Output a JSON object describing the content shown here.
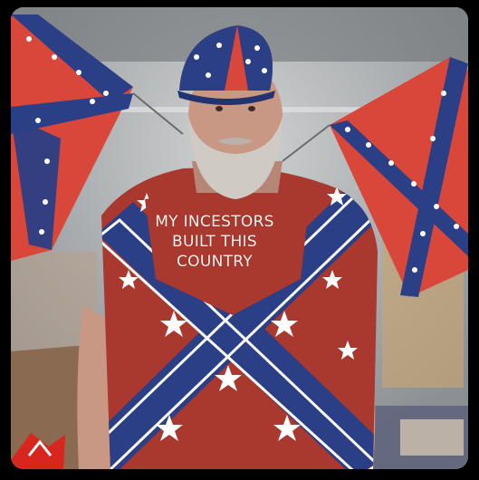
{
  "shirt": {
    "line1": "MY INCESTORS",
    "line2": "BUILT THIS",
    "line3": "COUNTRY"
  },
  "colors": {
    "flag_red": "#d9463a",
    "flag_blue": "#2b3f86",
    "star_white": "#ffffff",
    "beard": "#cfcac4",
    "skin": "#c99885",
    "background_wall": "#b9bcbd",
    "border": "#000000",
    "watermark_red": "#d8261e"
  },
  "watermark": {
    "text": "iFunny-like corner mark"
  }
}
